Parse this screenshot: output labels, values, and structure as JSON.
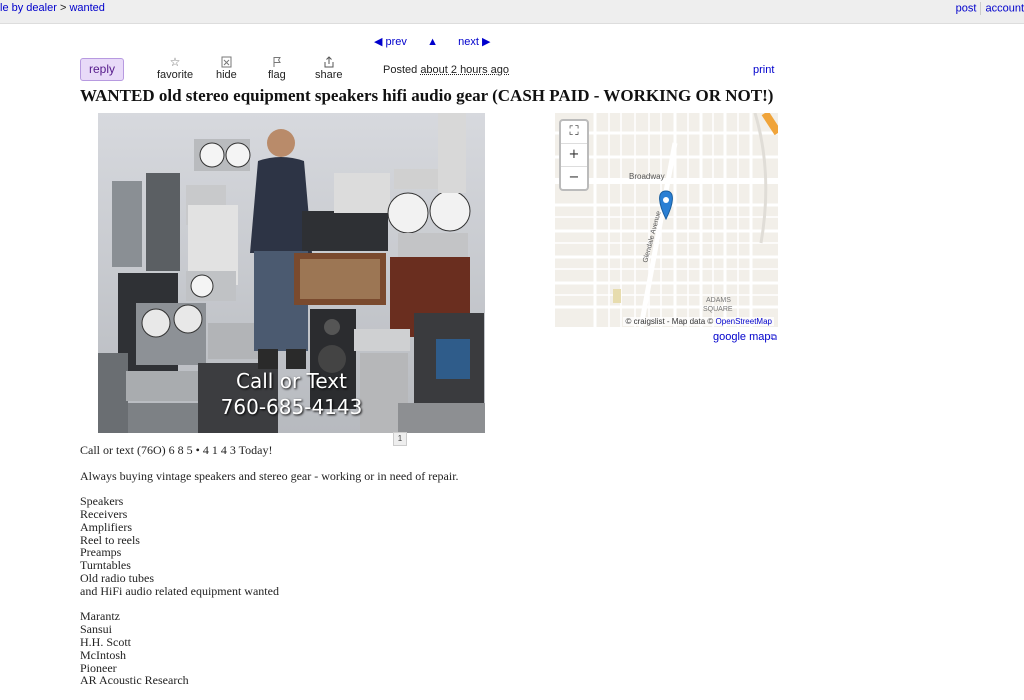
{
  "breadcrumb": {
    "dealer": "le by dealer",
    "separator": ">",
    "wanted": "wanted"
  },
  "toplinks": {
    "post": "post",
    "account": "account"
  },
  "pager": {
    "prev": "prev",
    "up": "▲",
    "next": "next"
  },
  "toolbar": {
    "reply": "reply",
    "favorite": "favorite",
    "hide": "hide",
    "flag": "flag",
    "share": "share",
    "posted_label": "Posted",
    "posted_when": "about 2 hours ago",
    "print": "print"
  },
  "title": "WANTED old stereo equipment speakers hifi audio gear (CASH PAID - WORKING OR NOT!)",
  "photo": {
    "caption_line1": "Call or Text",
    "caption_line2": "760-685-4143",
    "index": "1"
  },
  "map": {
    "street1": "Broadway",
    "street2": "Glendale Avenue",
    "area": "ADAMS SQUARE",
    "attribution_prefix": "© craigslist - Map data ©",
    "attribution_link": "OpenStreetMap",
    "google_map": "google map"
  },
  "body": {
    "intro": "Call or text (76O) 6 8 5 • 4 1 4 3 Today!",
    "tagline": "Always buying vintage speakers and stereo gear - working or in need of repair.",
    "categories": [
      "Speakers",
      "Receivers",
      "Amplifiers",
      "Reel to reels",
      "Preamps",
      "Turntables",
      "Old radio tubes",
      "and HiFi audio related equipment wanted"
    ],
    "brands": [
      "Marantz",
      "Sansui",
      "H.H. Scott",
      "McIntosh",
      "Pioneer",
      "AR Acoustic Research"
    ]
  },
  "colors": {
    "link": "#0000cc",
    "reply_bg": "#e8daf8",
    "reply_text": "#551a8b",
    "map_pin": "#2a7fd4"
  },
  "icons": {
    "favorite": "star-icon",
    "hide": "hide-icon",
    "flag": "flag-icon",
    "share": "share-icon",
    "fullscreen": "fullscreen-icon"
  }
}
